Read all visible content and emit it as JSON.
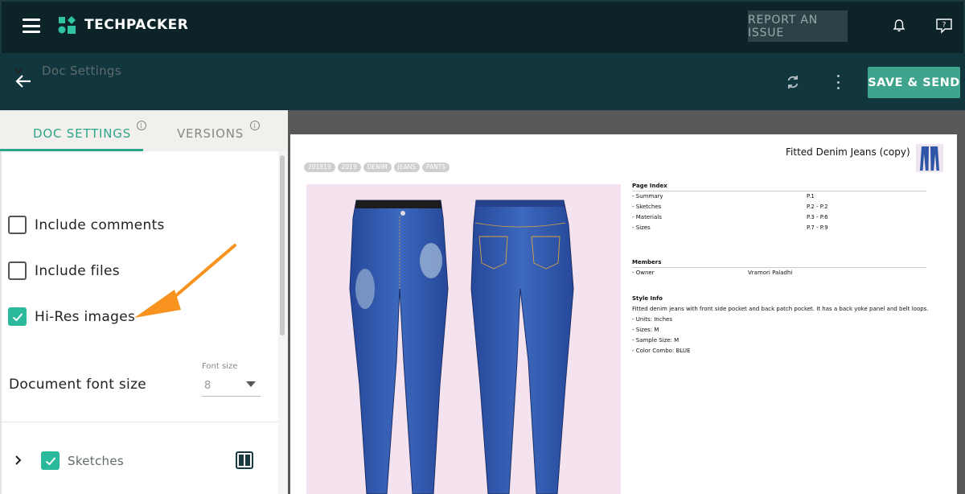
{
  "app": {
    "brand": "TECHPACKER"
  },
  "topbar": {
    "report_label": "REPORT AN ISSUE"
  },
  "toolbar": {
    "save_label": "SAVE & SEND"
  },
  "tabs": [
    {
      "label": "DOC SETTINGS",
      "active": true
    },
    {
      "label": "VERSIONS",
      "active": false
    }
  ],
  "doc_settings": {
    "section_title": "Doc Settings",
    "options": [
      {
        "label": "Include comments",
        "checked": false
      },
      {
        "label": "Include files",
        "checked": false
      },
      {
        "label": "Hi-Res images",
        "checked": true
      }
    ],
    "font_size_label": "Document font size",
    "font_size_small_label": "Font size",
    "font_size_value": "8"
  },
  "sections": [
    {
      "label": "Sketches",
      "checked": true
    }
  ],
  "preview": {
    "title": "Fitted Denim Jeans (copy)",
    "tags": [
      "201819",
      "2019",
      "DENIM",
      "JEANS",
      "PANTS"
    ],
    "page_index": {
      "heading": "Page Index",
      "rows": [
        {
          "name": "- Summary",
          "page": "P.1"
        },
        {
          "name": "- Sketches",
          "page": "P.2 - P.2"
        },
        {
          "name": "- Materials",
          "page": "P.3 - P.6"
        },
        {
          "name": "- Sizes",
          "page": "P.7 - P.9"
        }
      ]
    },
    "members": {
      "heading": "Members",
      "role": "- Owner",
      "name": "Vramori Paladhi"
    },
    "style_info": {
      "heading": "Style Info",
      "description": "Fitted denim jeans with front side pocket and back patch pocket. It has a back yoke panel and belt loops.",
      "lines": [
        "- Units: Inches",
        "- Sizes: M",
        "- Sample Size: M",
        "- Color Combo: BLUE"
      ]
    }
  },
  "colors": {
    "accent": "#2ea58b",
    "save_button": "#3fa48e",
    "header": "#0c2327",
    "subheader": "#11363d",
    "arrow": "#f7931e",
    "denim": "#2f56a6"
  }
}
